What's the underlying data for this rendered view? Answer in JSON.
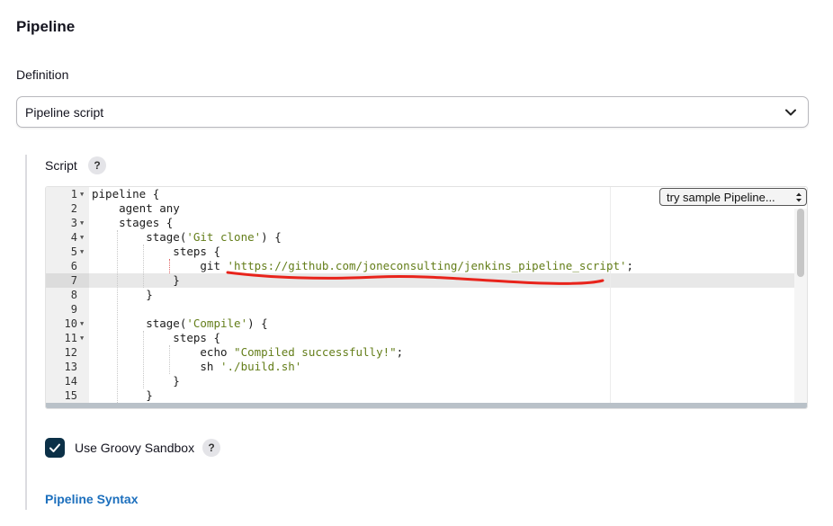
{
  "section_title": "Pipeline",
  "definition": {
    "label": "Definition",
    "selected": "Pipeline script",
    "icon": "chevron-down-icon"
  },
  "script": {
    "label": "Script",
    "help": "?",
    "sample_select": "try sample Pipeline...",
    "lines": [
      {
        "n": "1",
        "fold": true,
        "parts": [
          {
            "t": "pipeline {",
            "c": "plain"
          }
        ]
      },
      {
        "n": "2",
        "fold": false,
        "parts": [
          {
            "t": "    agent any",
            "c": "plain"
          }
        ]
      },
      {
        "n": "3",
        "fold": true,
        "parts": [
          {
            "t": "    stages {",
            "c": "plain"
          }
        ]
      },
      {
        "n": "4",
        "fold": true,
        "parts": [
          {
            "t": "        stage(",
            "c": "plain"
          },
          {
            "t": "'Git clone'",
            "c": "str"
          },
          {
            "t": ") {",
            "c": "plain"
          }
        ]
      },
      {
        "n": "5",
        "fold": true,
        "parts": [
          {
            "t": "            steps {",
            "c": "plain"
          }
        ]
      },
      {
        "n": "6",
        "fold": false,
        "parts": [
          {
            "t": "                git ",
            "c": "plain"
          },
          {
            "t": "'https://github.com/joneconsulting/jenkins_pipeline_script'",
            "c": "str"
          },
          {
            "t": ";",
            "c": "plain"
          }
        ]
      },
      {
        "n": "7",
        "fold": false,
        "parts": [
          {
            "t": "            }",
            "c": "plain"
          }
        ]
      },
      {
        "n": "8",
        "fold": false,
        "parts": [
          {
            "t": "        }",
            "c": "plain"
          }
        ]
      },
      {
        "n": "9",
        "fold": false,
        "parts": [
          {
            "t": "",
            "c": "plain"
          }
        ]
      },
      {
        "n": "10",
        "fold": true,
        "parts": [
          {
            "t": "        stage(",
            "c": "plain"
          },
          {
            "t": "'Compile'",
            "c": "str"
          },
          {
            "t": ") {",
            "c": "plain"
          }
        ]
      },
      {
        "n": "11",
        "fold": true,
        "parts": [
          {
            "t": "            steps {",
            "c": "plain"
          }
        ]
      },
      {
        "n": "12",
        "fold": false,
        "parts": [
          {
            "t": "                echo ",
            "c": "plain"
          },
          {
            "t": "\"Compiled successfully!\"",
            "c": "str"
          },
          {
            "t": ";",
            "c": "plain"
          }
        ]
      },
      {
        "n": "13",
        "fold": false,
        "parts": [
          {
            "t": "                sh ",
            "c": "plain"
          },
          {
            "t": "'./build.sh'",
            "c": "str"
          }
        ]
      },
      {
        "n": "14",
        "fold": false,
        "parts": [
          {
            "t": "            }",
            "c": "plain"
          }
        ]
      },
      {
        "n": "15",
        "fold": false,
        "parts": [
          {
            "t": "        }",
            "c": "plain"
          }
        ]
      }
    ]
  },
  "sandbox": {
    "label": "Use Groovy Sandbox",
    "checked": true,
    "help": "?"
  },
  "syntax_link": "Pipeline Syntax",
  "colors": {
    "link": "#1c6fbd",
    "checkbox": "#0b3047",
    "string": "#647e1a",
    "annotation": "#e8231b"
  }
}
